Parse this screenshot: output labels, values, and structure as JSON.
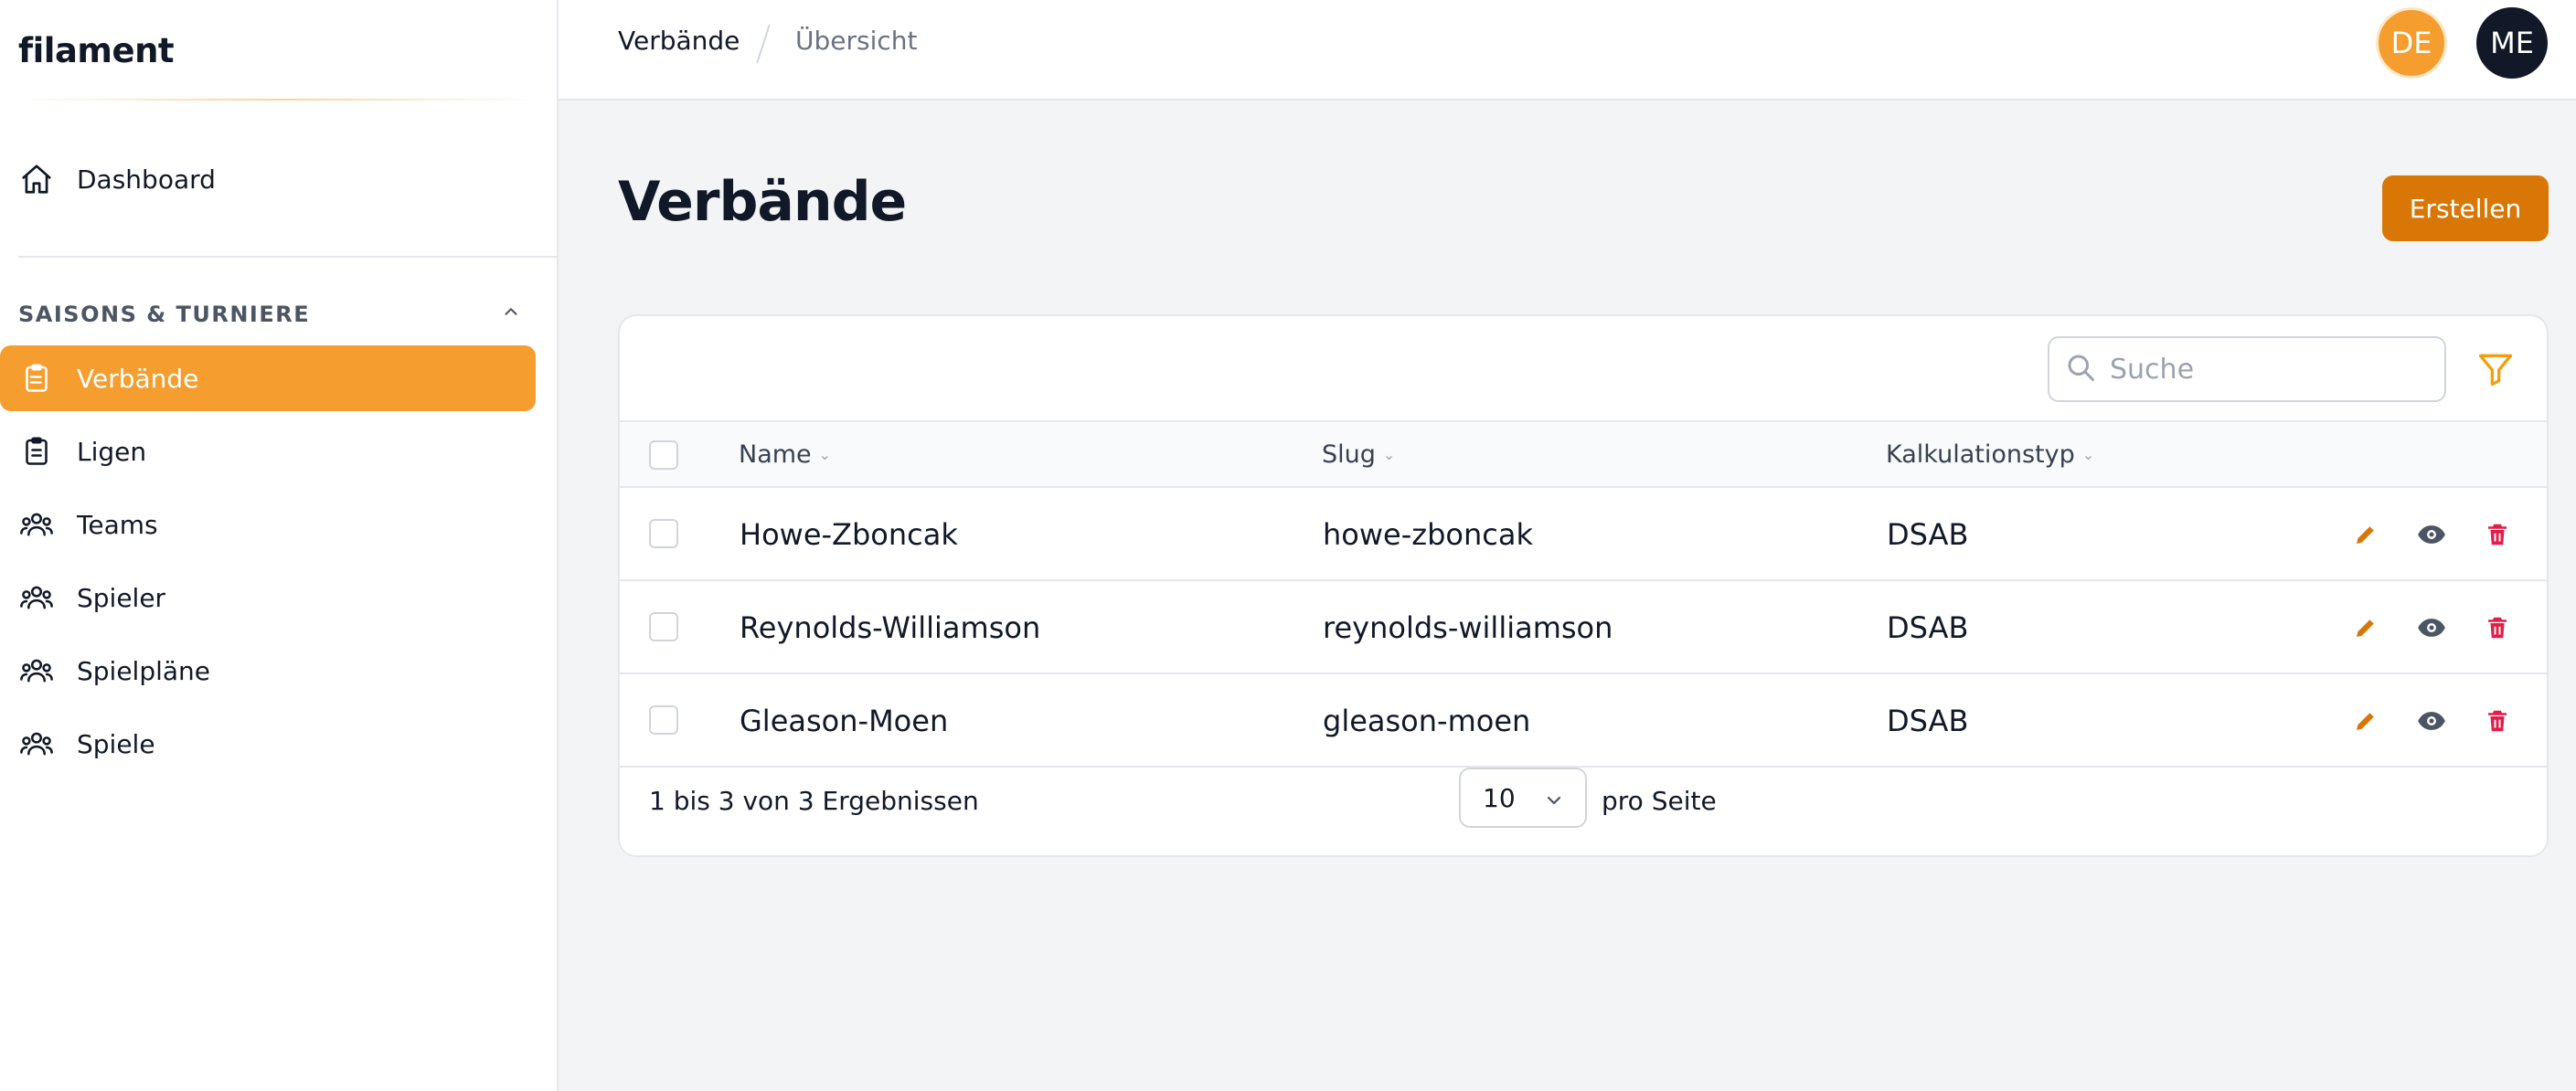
{
  "brand": {
    "name": "filament"
  },
  "sidebar": {
    "dashboard": {
      "label": "Dashboard",
      "icon": "home-icon"
    },
    "group": {
      "label": "SAISONS & TURNIERE"
    },
    "items": [
      {
        "label": "Verbände",
        "icon": "clipboard-icon",
        "active": true
      },
      {
        "label": "Ligen",
        "icon": "clipboard-icon"
      },
      {
        "label": "Teams",
        "icon": "user-group-icon"
      },
      {
        "label": "Spieler",
        "icon": "user-group-icon"
      },
      {
        "label": "Spielpläne",
        "icon": "user-group-icon"
      },
      {
        "label": "Spiele",
        "icon": "user-group-icon"
      }
    ]
  },
  "topbar": {
    "breadcrumb": [
      "Verbände",
      "Übersicht"
    ],
    "avatars": [
      {
        "initials": "DE",
        "color": "#f59e2f"
      },
      {
        "initials": "ME",
        "color": "#111827"
      }
    ]
  },
  "page": {
    "title": "Verbände",
    "create_label": "Erstellen"
  },
  "table": {
    "search_placeholder": "Suche",
    "columns": [
      "Name",
      "Slug",
      "Kalkulationstyp"
    ],
    "rows": [
      {
        "name": "Howe-Zboncak",
        "slug": "howe-zboncak",
        "type": "DSAB"
      },
      {
        "name": "Reynolds-Williamson",
        "slug": "reynolds-williamson",
        "type": "DSAB"
      },
      {
        "name": "Gleason-Moen",
        "slug": "gleason-moen",
        "type": "DSAB"
      }
    ],
    "results_text": "1 bis 3 von 3 Ergebnissen",
    "per_page_value": "10",
    "per_page_label": "pro Seite"
  },
  "colors": {
    "accent": "#f59e2f",
    "primary_button": "#d97706",
    "danger": "#e11d48",
    "edit": "#d97706",
    "view": "#4b5563"
  }
}
